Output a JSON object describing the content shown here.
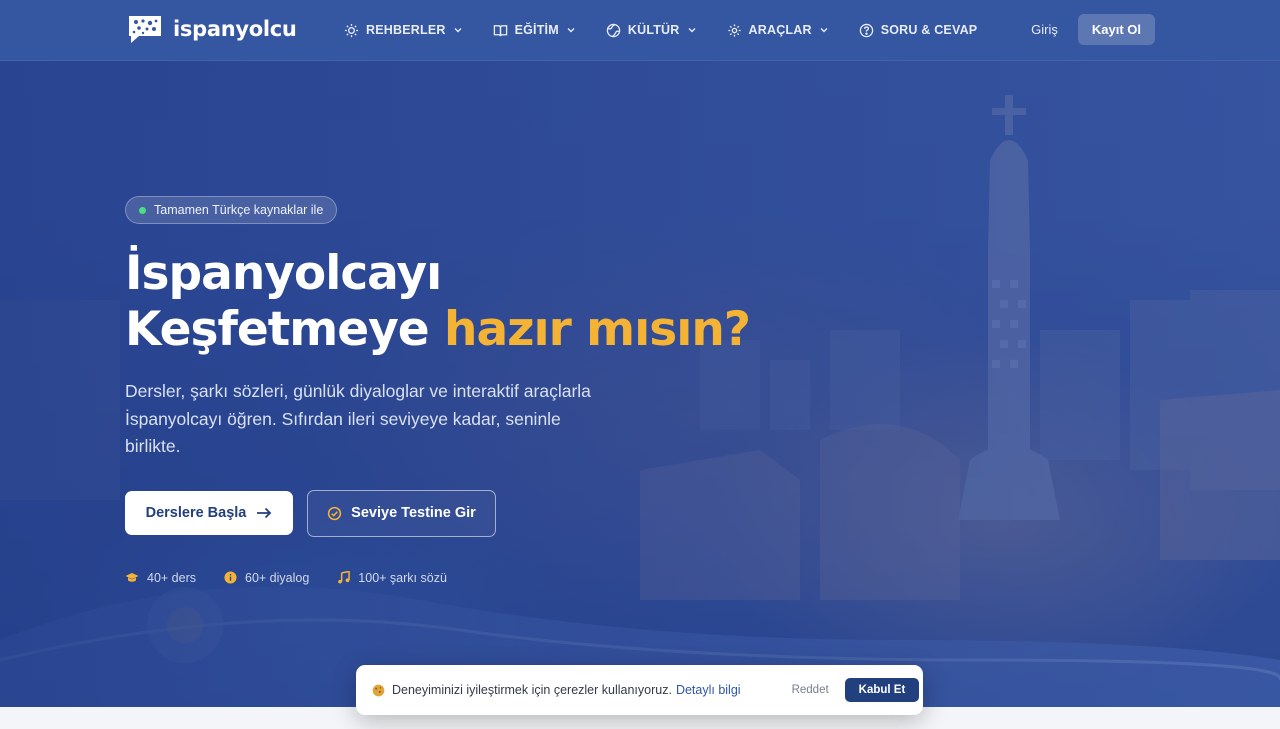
{
  "brand": {
    "name": "ispanyolcu"
  },
  "nav": {
    "items": [
      {
        "label": "REHBERLER",
        "icon": "lightbulb-icon"
      },
      {
        "label": "EĞİTİM",
        "icon": "book-icon"
      },
      {
        "label": "KÜLTÜR",
        "icon": "globe-icon"
      },
      {
        "label": "ARAÇLAR",
        "icon": "gear-icon"
      },
      {
        "label": "SORU & CEVAP",
        "icon": "question-icon"
      }
    ],
    "login": "Giriş",
    "signup": "Kayıt Ol"
  },
  "hero": {
    "badge": "Tamamen Türkçe kaynaklar ile",
    "title_line1": "İspanyolcayı",
    "title_line2_plain": "Keşfetmeye",
    "title_line2_accent": "hazır mısın?",
    "subtitle": "Dersler, şarkı sözleri, günlük diyaloglar ve interaktif araçlarla İspanyolcayı öğren. Sıfırdan ileri seviyeye kadar, seninle birlikte.",
    "primary_cta": "Derslere Başla",
    "secondary_cta": "Seviye Testine Gir",
    "stats": [
      {
        "label": "40+ ders",
        "icon": "graduation-cap-icon"
      },
      {
        "label": "60+ diyalog",
        "icon": "info-icon"
      },
      {
        "label": "100+ şarkı sözü",
        "icon": "music-note-icon"
      }
    ]
  },
  "cookie": {
    "text": "Deneyiminizi iyileştirmek için çerezler kullanıyoruz.",
    "link": "Detaylı bilgi",
    "reject": "Reddet",
    "accept": "Kabul Et"
  },
  "colors": {
    "header_bg": "#3556a0",
    "accent": "#f5b335",
    "primary_dark": "#23407e",
    "badge_dot": "#4ade80"
  }
}
